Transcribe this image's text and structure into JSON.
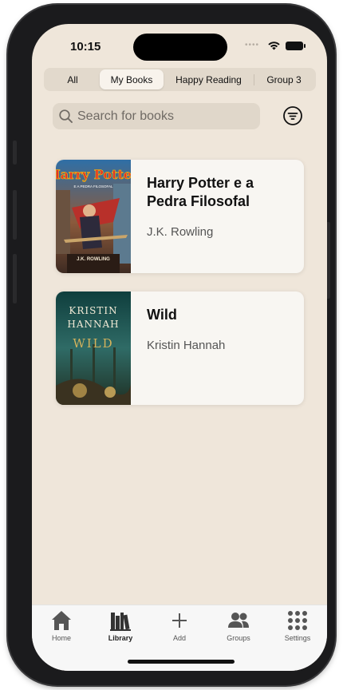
{
  "status_bar": {
    "time": "10:15"
  },
  "tabs": [
    {
      "label": "All",
      "selected": false
    },
    {
      "label": "My Books",
      "selected": true
    },
    {
      "label": "Happy Reading",
      "selected": false
    },
    {
      "label": "Group 3",
      "selected": false
    }
  ],
  "search": {
    "placeholder": "Search for books",
    "value": ""
  },
  "books": [
    {
      "title": "Harry Potter e a Pedra Filosofal",
      "author": "J.K. Rowling",
      "cover_text_top": "Harry Potter",
      "cover_text_sub": "E A PEDRA FILOSOFAL",
      "cover_text_author": "J.K. ROWLING"
    },
    {
      "title": "Wild",
      "author": "Kristin Hannah",
      "cover_text_top": "KRISTIN",
      "cover_text_sub": "HANNAH",
      "cover_text_title": "WILD"
    }
  ],
  "tabbar": {
    "items": [
      {
        "label": "Home",
        "icon": "house-icon",
        "active": false
      },
      {
        "label": "Library",
        "icon": "books-icon",
        "active": true
      },
      {
        "label": "Add",
        "icon": "plus-icon",
        "active": false
      },
      {
        "label": "Groups",
        "icon": "people-icon",
        "active": false
      },
      {
        "label": "Settings",
        "icon": "grid-icon",
        "active": false
      }
    ]
  },
  "colors": {
    "background": "#efe6da",
    "segment_bg": "#e2d9cc",
    "card_bg": "#f8f6f2",
    "tabbar_bg": "#f7f7f7",
    "icon": "#555555"
  }
}
